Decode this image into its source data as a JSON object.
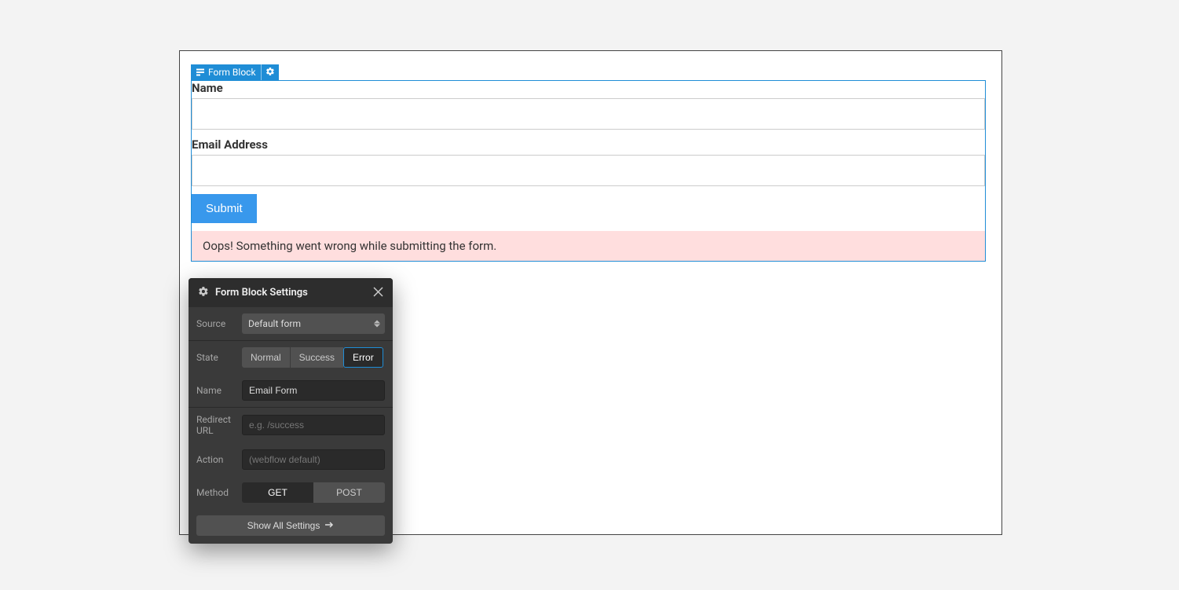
{
  "block_tag": {
    "label": "Form Block"
  },
  "form": {
    "name_label": "Name",
    "email_label": "Email Address",
    "submit_label": "Submit",
    "error_message": "Oops! Something went wrong while submitting the form."
  },
  "settings": {
    "title": "Form Block Settings",
    "source": {
      "label": "Source",
      "value": "Default form"
    },
    "state": {
      "label": "State",
      "options": [
        "Normal",
        "Success",
        "Error"
      ],
      "selected": "Error"
    },
    "name": {
      "label": "Name",
      "value": "Email Form"
    },
    "redirect": {
      "label": "Redirect URL",
      "placeholder": "e.g. /success"
    },
    "action": {
      "label": "Action",
      "placeholder": "(webflow default)"
    },
    "method": {
      "label": "Method",
      "options": [
        "GET",
        "POST"
      ],
      "selected": "GET"
    },
    "show_all_label": "Show All Settings"
  }
}
